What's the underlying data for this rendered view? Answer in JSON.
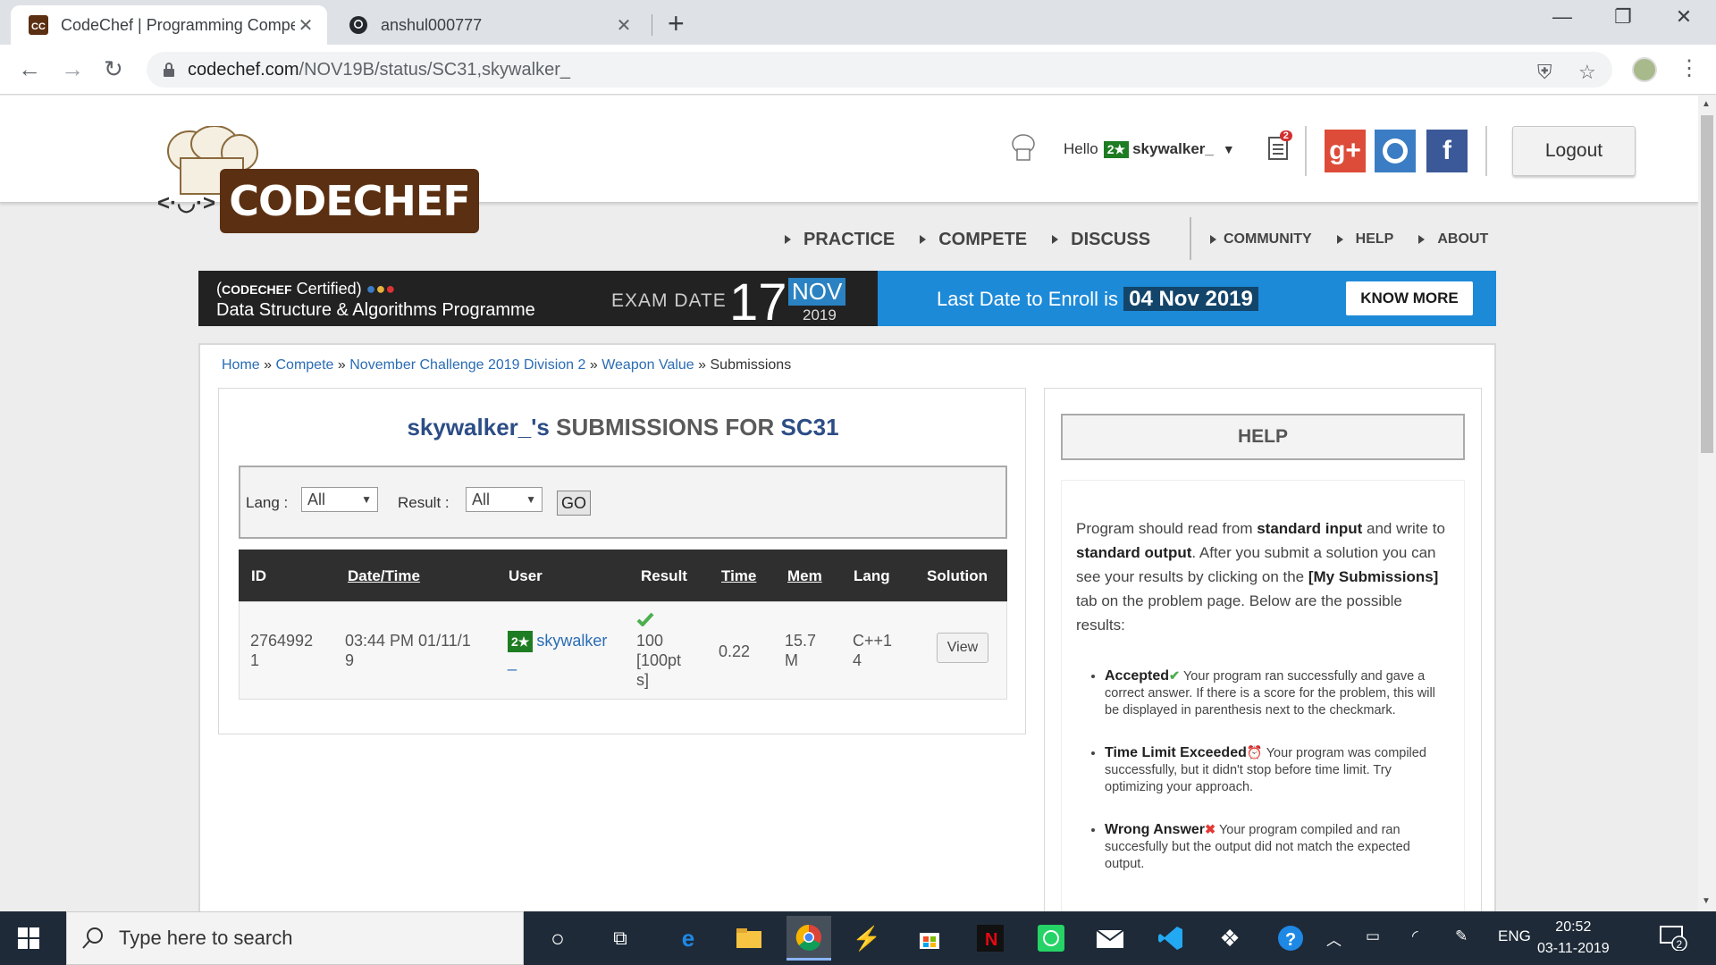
{
  "browser": {
    "tabs": [
      {
        "favicon": "codechef-favicon",
        "title": "CodeChef | Programming Compe"
      },
      {
        "favicon": "github-icon",
        "title": "anshul000777"
      }
    ],
    "url_domain": "codechef.com",
    "url_path": "/NOV19B/status/SC31,skywalker_"
  },
  "header": {
    "logo_text": "CODECHEF",
    "greeting": "Hello",
    "rating_badge": "2★",
    "username": "skywalker_",
    "notification_count": "2",
    "social": [
      "g+",
      "github",
      "f"
    ],
    "logout_label": "Logout"
  },
  "nav": {
    "primary": [
      "PRACTICE",
      "COMPETE",
      "DISCUSS"
    ],
    "secondary": [
      "COMMUNITY",
      "HELP",
      "ABOUT"
    ]
  },
  "banner": {
    "certified_brand": "CODECHEF",
    "certified": "Certified",
    "programme": "Data Structure & Algorithms Programme",
    "exam_label": "EXAM DATE",
    "exam_day": "17",
    "exam_month": "NOV",
    "exam_year": "2019",
    "enroll_text": "Last Date to Enroll is",
    "enroll_date": "04 Nov 2019",
    "cta": "KNOW MORE"
  },
  "breadcrumb": {
    "home": "Home",
    "compete": "Compete",
    "contest": "November Challenge 2019 Division 2",
    "problem": "Weapon Value",
    "current": "Submissions",
    "sep": "»"
  },
  "submissions": {
    "title_user": "skywalker_'s",
    "title_mid": "SUBMISSIONS FOR",
    "title_code": "SC31",
    "filter": {
      "lang_label": "Lang :",
      "lang_value": "All",
      "result_label": "Result :",
      "result_value": "All",
      "go_label": "GO"
    },
    "columns": [
      "ID",
      "Date/Time",
      "User",
      "Result",
      "Time",
      "Mem",
      "Lang",
      "Solution"
    ],
    "rows": [
      {
        "id_1": "2764992",
        "id_2": "1",
        "datetime_1": "03:44 PM 01/11/1",
        "datetime_2": "9",
        "user_badge": "2★",
        "user_1": "skywalker",
        "user_2": "_",
        "result_icon": "checkmark-icon",
        "result_1": "100",
        "result_2": "[100pt",
        "result_3": "s]",
        "time": "0.22",
        "mem_1": "15.7",
        "mem_2": "M",
        "lang_1": "C++1",
        "lang_2": "4",
        "solution": "View"
      }
    ]
  },
  "help": {
    "title": "HELP",
    "intro_1": "Program should read from",
    "intro_b1": "standard input",
    "intro_2": "and write to",
    "intro_b2": "standard output",
    "intro_3": ". After you submit a solution you can see your results by clicking on the",
    "intro_b3": "[My Submissions]",
    "intro_4": "tab on the problem page. Below are the possible results:",
    "results": [
      {
        "name": "Accepted",
        "icon": "checkmark-icon",
        "desc": "Your program ran successfully and gave a correct answer. If there is a score for the problem, this will be displayed in parenthesis next to the checkmark."
      },
      {
        "name": "Time Limit Exceeded",
        "icon": "clock-icon",
        "desc": "Your program was compiled successfully, but it didn't stop before time limit. Try optimizing your approach."
      },
      {
        "name": "Wrong Answer",
        "icon": "cross-icon",
        "desc": "Your program compiled and ran succesfully but the output did not match the expected output."
      }
    ]
  },
  "taskbar": {
    "search_placeholder": "Type here to search",
    "language": "ENG",
    "time": "20:52",
    "date": "03-11-2019",
    "notifications": "2"
  },
  "colors": {
    "link": "#2a6db5",
    "brand_brown": "#5b2f12",
    "banner_blue": "#1d8ad8",
    "accepted_green": "#4caf50",
    "table_header": "#2f2f2f"
  }
}
